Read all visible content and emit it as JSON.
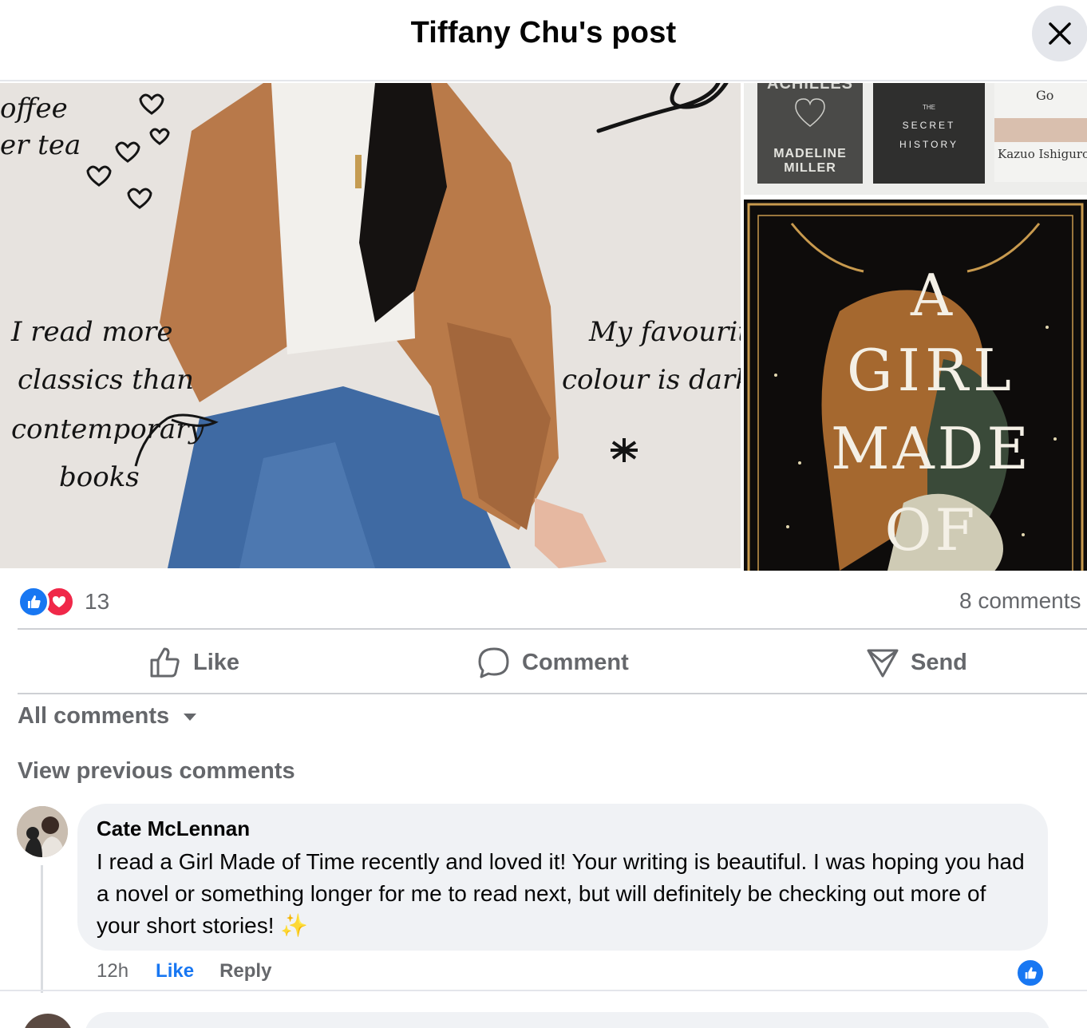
{
  "header": {
    "title": "Tiffany Chu's post"
  },
  "photos": {
    "main_overlay_text": {
      "top_left_1": "offee",
      "top_left_2": "er tea",
      "middle_left_1": "I read more",
      "middle_left_2": "classics than",
      "middle_left_3": "contemporary",
      "middle_left_4": "books",
      "right_1": "My favourite",
      "right_2": "colour is dark t"
    },
    "books": {
      "book1_title": "ACHILLES",
      "book1_author": "MADELINE MILLER",
      "book2_title_1": "THE",
      "book2_title_2": "SECRET",
      "book2_title_3": "HISTORY",
      "book3_title": "Go",
      "book3_author": "Kazuo Ishiguro"
    },
    "cover_title": [
      "A",
      "GIRL",
      "MADE",
      "OF"
    ]
  },
  "reactions": {
    "count": "13",
    "comments": "8 comments"
  },
  "actions": {
    "like": "Like",
    "comment": "Comment",
    "send": "Send"
  },
  "filter": {
    "label": "All comments"
  },
  "view_previous": "View previous comments",
  "comment": {
    "author": "Cate McLennan",
    "text": "I read a Girl Made of Time recently and loved it! Your writing is beautiful. I was hoping you had a novel or something longer for me to read next, but will definitely be checking out more of your short stories! ",
    "emoji": "✨",
    "time": "12h",
    "like": "Like",
    "reply": "Reply"
  },
  "colors": {
    "accent": "#1877f2",
    "love": "#f02849",
    "muted": "#65676b",
    "bubble": "#f0f2f5"
  }
}
